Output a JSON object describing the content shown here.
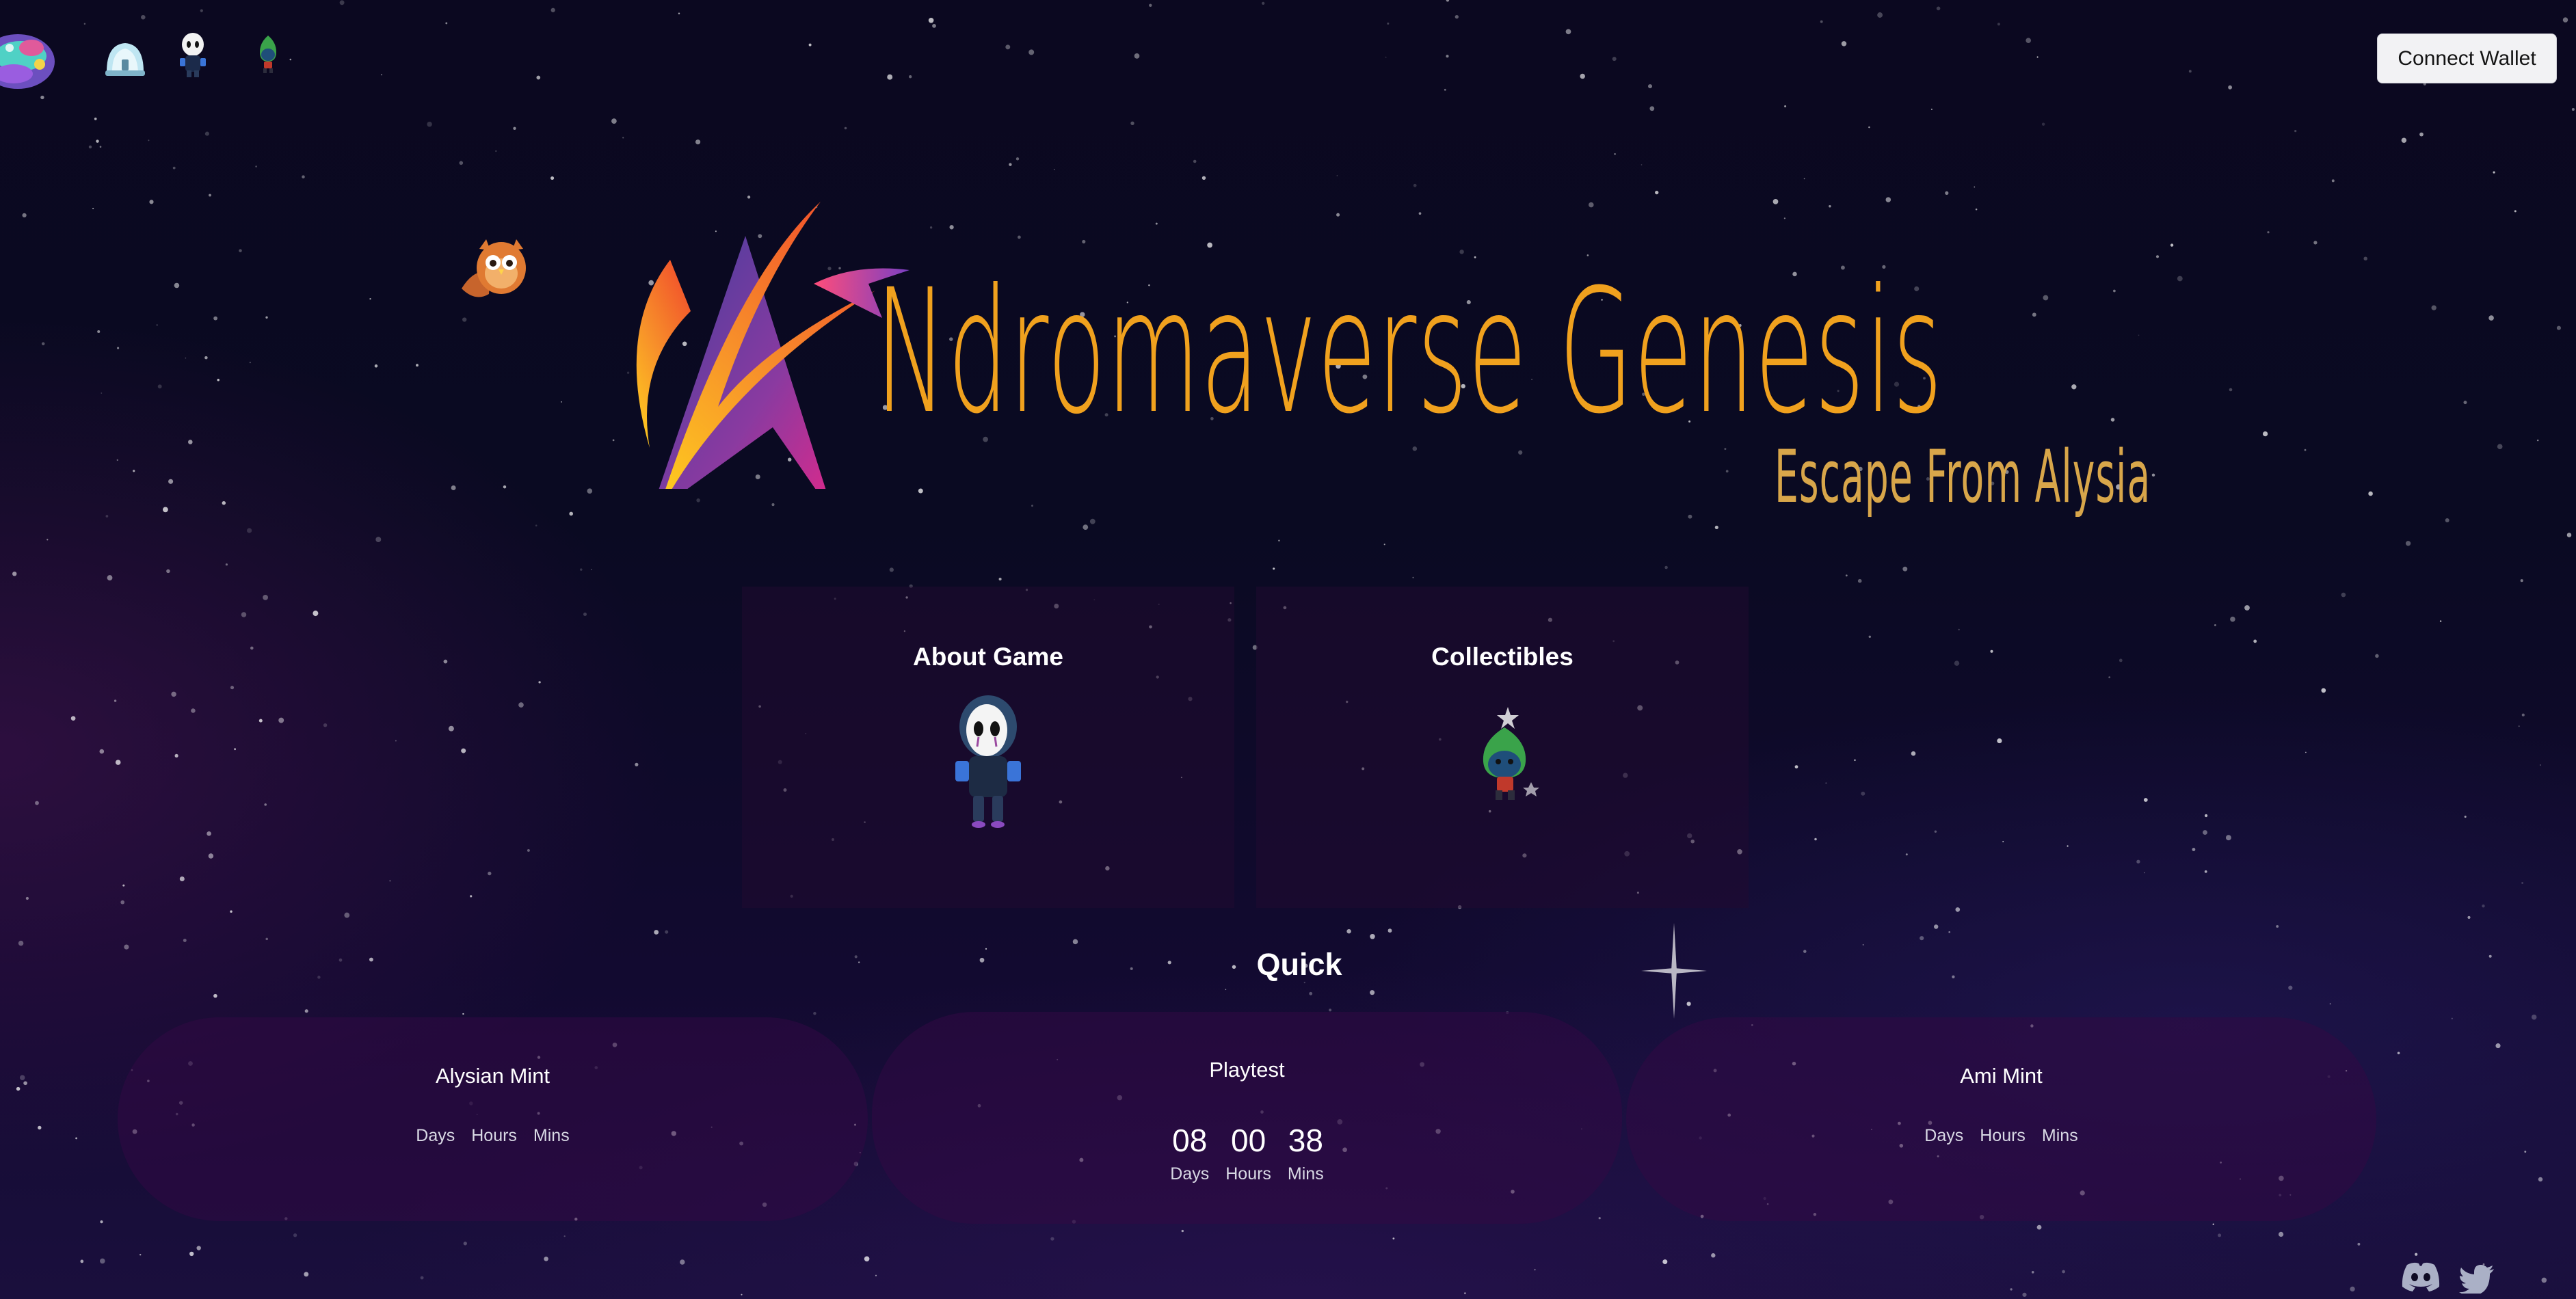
{
  "nav": {
    "logo_icon": "planet-icon",
    "items": [
      {
        "icon": "dome-icon"
      },
      {
        "icon": "masked-character-icon"
      },
      {
        "icon": "leaf-character-icon"
      }
    ]
  },
  "wallet": {
    "connect_label": "Connect Wallet"
  },
  "hero": {
    "title": "Ndromaverse Genesis",
    "subtitle": "Escape From Alysia",
    "logo_icon": "flame-star-logo",
    "owl_icon": "owl-icon"
  },
  "features": [
    {
      "title": "About Game",
      "icon": "masked-character-icon"
    },
    {
      "title": "Collectibles",
      "icon": "leaf-character-icon"
    }
  ],
  "quick": {
    "title": "Quick",
    "cards": [
      {
        "name": "Alysian Mint",
        "countdown": {
          "days": "",
          "hours": "",
          "mins": ""
        },
        "labels": {
          "days": "Days",
          "hours": "Hours",
          "mins": "Mins"
        }
      },
      {
        "name": "Playtest",
        "countdown": {
          "days": "08",
          "hours": "00",
          "mins": "38"
        },
        "labels": {
          "days": "Days",
          "hours": "Hours",
          "mins": "Mins"
        }
      },
      {
        "name": "Ami Mint",
        "countdown": {
          "days": "",
          "hours": "",
          "mins": ""
        },
        "labels": {
          "days": "Days",
          "hours": "Hours",
          "mins": "Mins"
        }
      }
    ]
  },
  "social": [
    {
      "icon": "discord-icon"
    },
    {
      "icon": "twitter-icon"
    }
  ],
  "colors": {
    "title": "#f0a11e",
    "subtitle": "#d8a64a",
    "background": "#0b0820",
    "card": "#220a30"
  }
}
